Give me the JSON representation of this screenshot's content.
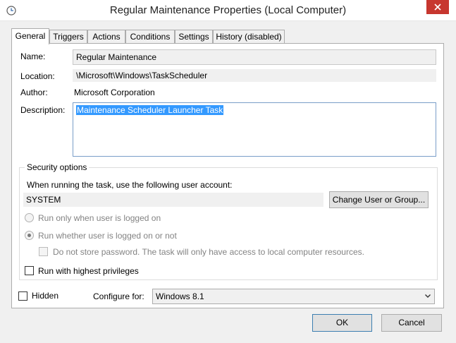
{
  "window": {
    "title": "Regular Maintenance Properties (Local Computer)",
    "app_icon": "clock-icon",
    "close_icon": "close-icon"
  },
  "tabs": [
    {
      "label": "General",
      "active": true
    },
    {
      "label": "Triggers"
    },
    {
      "label": "Actions"
    },
    {
      "label": "Conditions"
    },
    {
      "label": "Settings"
    },
    {
      "label": "History (disabled)"
    }
  ],
  "general": {
    "name_label": "Name:",
    "name_value": "Regular Maintenance",
    "location_label": "Location:",
    "location_value": "\\Microsoft\\Windows\\TaskScheduler",
    "author_label": "Author:",
    "author_value": "Microsoft Corporation",
    "description_label": "Description:",
    "description_value": "Maintenance Scheduler Launcher Task"
  },
  "security": {
    "title": "Security options",
    "account_prompt": "When running the task, use the following user account:",
    "account_value": "SYSTEM",
    "change_button": "Change User or Group...",
    "radio_logged_on": "Run only when user is logged on",
    "radio_whether": "Run whether user is logged on or not",
    "selected_radio": "whether",
    "no_store_password": "Do not store password.  The task will only have access to local computer resources.",
    "highest_privileges": "Run with highest privileges"
  },
  "footer": {
    "hidden_label": "Hidden",
    "configure_label": "Configure for:",
    "configure_value": "Windows 8.1",
    "ok": "OK",
    "cancel": "Cancel"
  },
  "colors": {
    "accent": "#3399ff",
    "close": "#c7372f"
  }
}
